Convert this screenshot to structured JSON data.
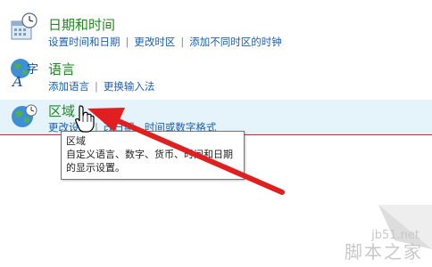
{
  "categories": {
    "datetime": {
      "title": "日期和时间",
      "links": [
        "设置时间和日期",
        "更改时区",
        "添加不同时区的时钟"
      ],
      "icon": "calendar-clock-icon"
    },
    "language": {
      "title": "语言",
      "links": [
        "添加语言",
        "更换输入法"
      ],
      "icon": "language-globe-icon"
    },
    "region": {
      "title": "区域",
      "links_visible": [
        "更改设置",
        "改日期、时间或数字格式"
      ],
      "icon": "region-globe-clock-icon"
    }
  },
  "tooltip": {
    "title": "区域",
    "body": "自定义语言、数字、货币、时间和日期的显示设置。"
  },
  "watermark": {
    "site": "jb51.net",
    "name": "脚本之家"
  },
  "colors": {
    "title_green": "#1e8a1e",
    "link_blue": "#1a5fb4",
    "hover_bg": "#e5f3fb",
    "arrow_red": "#e02020"
  }
}
